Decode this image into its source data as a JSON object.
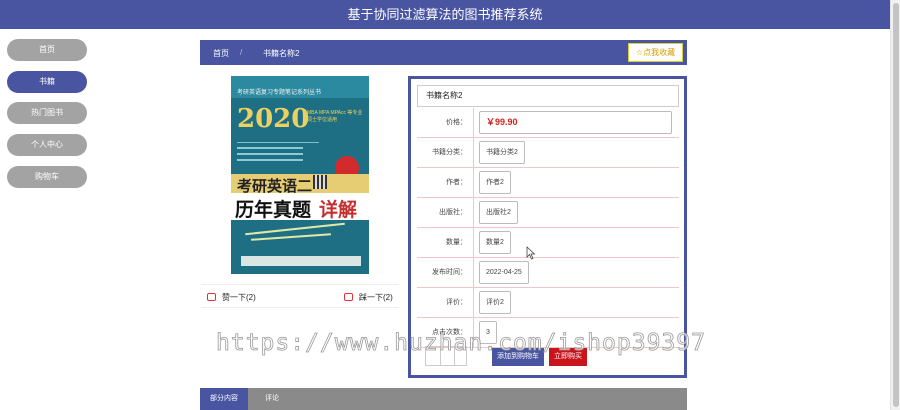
{
  "header": {
    "title": "基于协同过滤算法的图书推荐系统"
  },
  "sidebar": {
    "items": [
      {
        "label": "首页",
        "active": false
      },
      {
        "label": "书籍",
        "active": true
      },
      {
        "label": "热门图书",
        "active": false
      },
      {
        "label": "个人中心",
        "active": false
      },
      {
        "label": "购物车",
        "active": false
      }
    ]
  },
  "breadcrumb": {
    "home": "首页",
    "separator": "/",
    "current": "书籍名称2"
  },
  "favorite": {
    "label": "☆点我收藏"
  },
  "cover": {
    "series": "考研英语复习专题笔记系列丛书",
    "year": "2020",
    "year_note": "MBA MPA MPAcc 等专业硕士学位适用",
    "subject": "考研英语二",
    "title_main": "历年真题",
    "title_accent": "详解"
  },
  "votes": {
    "up": "赞一下(2)",
    "down": "踩一下(2)"
  },
  "book": {
    "name": "书籍名称2",
    "fields": [
      {
        "label": "价格：",
        "value": "￥99.90"
      },
      {
        "label": "书籍分类：",
        "value": "书籍分类2"
      },
      {
        "label": "作者：",
        "value": "作者2"
      },
      {
        "label": "出版社：",
        "value": "出版社2"
      },
      {
        "label": "数量：",
        "value": "数量2"
      },
      {
        "label": "发布时间：",
        "value": "2022-04-25"
      },
      {
        "label": "评价：",
        "value": "评价2"
      },
      {
        "label": "点击次数：",
        "value": "3"
      }
    ]
  },
  "actions": {
    "add_cart": "添加到购物车",
    "buy_now": "立即购买"
  },
  "watermark": "https://www.huzhan.com/ishop39397",
  "tabs": [
    {
      "label": "部分内容"
    },
    {
      "label": "评论"
    }
  ],
  "colors": {
    "primary": "#4a55a2",
    "danger": "#c9141b",
    "inactive": "#a3a3a3"
  }
}
